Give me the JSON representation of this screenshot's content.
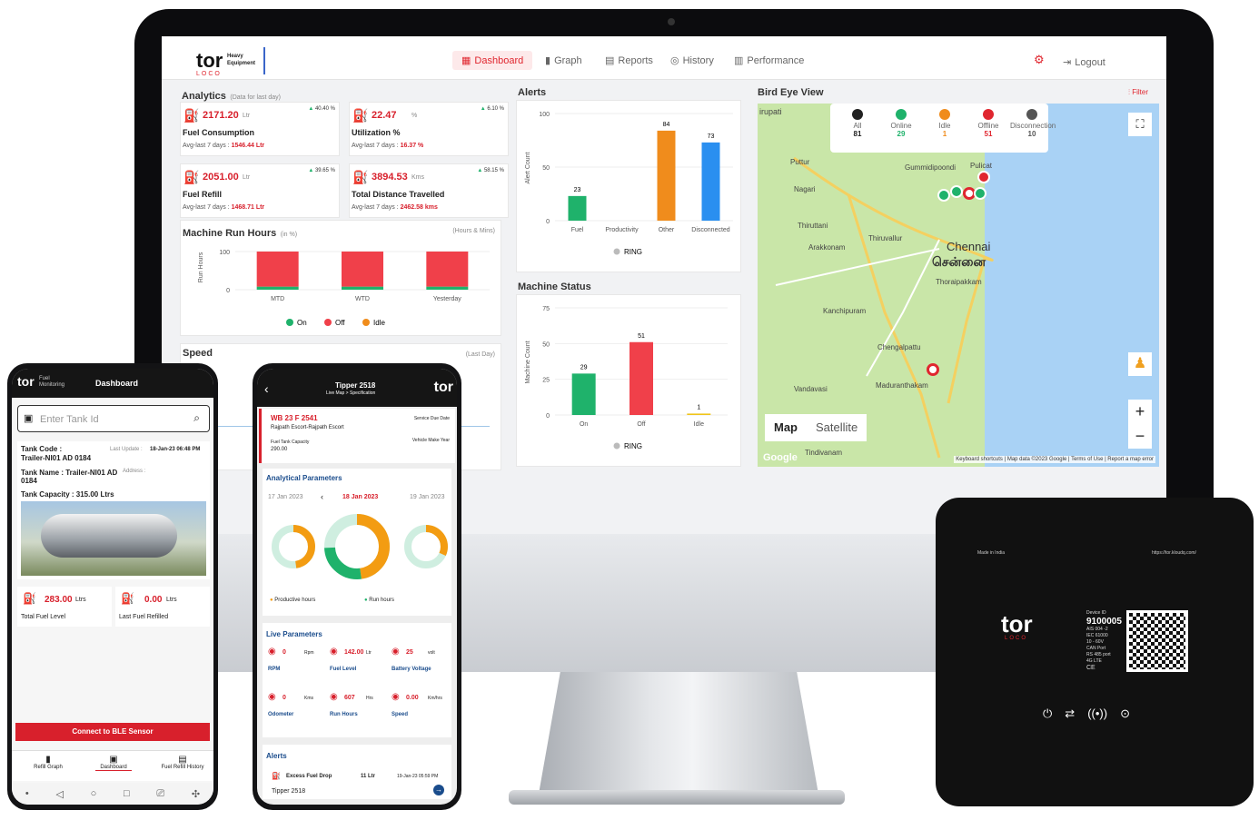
{
  "web": {
    "logo": {
      "brand": "tor",
      "sub1": "Heavy",
      "sub2": "Equipment",
      "loco": "LOCO"
    },
    "nav": [
      {
        "label": "Dashboard",
        "icon": "grid-icon"
      },
      {
        "label": "Graph",
        "icon": "bar-chart-icon"
      },
      {
        "label": "Reports",
        "icon": "report-icon"
      },
      {
        "label": "History",
        "icon": "history-icon"
      },
      {
        "label": "Performance",
        "icon": "performance-icon"
      }
    ],
    "logout": "Logout",
    "analytics": {
      "title": "Analytics",
      "subtitle": "(Data for last day)",
      "cards": [
        {
          "value": "2171.20",
          "unit": "Ltr",
          "pct": "40.40 %",
          "label": "Fuel Consumption",
          "avg_label": "Avg-last 7 days :",
          "avg_value": "1546.44 Ltr"
        },
        {
          "value": "22.47",
          "unit": "%",
          "pct": "6.10 %",
          "label": "Utilization %",
          "avg_label": "Avg-last 7 days :",
          "avg_value": "16.37 %"
        },
        {
          "value": "2051.00",
          "unit": "Ltr",
          "pct": "39.65 %",
          "label": "Fuel Refill",
          "avg_label": "Avg-last 7 days :",
          "avg_value": "1468.71 Ltr"
        },
        {
          "value": "3894.53",
          "unit": "Kms",
          "pct": "58.15 %",
          "label": "Total Distance Travelled",
          "avg_label": "Avg-last 7 days :",
          "avg_value": "2462.58 kms"
        }
      ]
    },
    "run_hours": {
      "title": "Machine Run Hours",
      "unit": "(in %)",
      "right": "(Hours & Mins)",
      "ylabel": "Run Hours",
      "chart_data": {
        "type": "bar",
        "stacked": true,
        "categories": [
          "MTD",
          "WTD",
          "Yesterday"
        ],
        "series": [
          {
            "name": "On",
            "values": [
              8,
              8,
              8
            ],
            "color": "#1fb26b"
          },
          {
            "name": "Off",
            "values": [
              92,
              92,
              92
            ],
            "color": "#f0404a"
          },
          {
            "name": "Idle",
            "values": [
              0,
              0,
              0
            ],
            "color": "#f08c1c"
          }
        ],
        "ylim": [
          0,
          100
        ],
        "yticks": [
          "100",
          "0"
        ]
      }
    },
    "speed": {
      "title": "Speed",
      "right": "(Last Day)"
    },
    "alerts": {
      "title": "Alerts",
      "ylabel": "Alert Count",
      "legend": "RING",
      "chart_data": {
        "type": "bar",
        "categories": [
          "Fuel",
          "Productivity",
          "Other",
          "Disconnected"
        ],
        "values": [
          23,
          0,
          84,
          73
        ],
        "colors": [
          "#1fb26b",
          "#9b59b6",
          "#f08c1c",
          "#2a8ff0"
        ],
        "ylim": [
          0,
          100
        ],
        "yticks": [
          "100",
          "50",
          "0"
        ]
      }
    },
    "machine_status": {
      "title": "Machine Status",
      "ylabel": "Machine Count",
      "legend": "RING",
      "chart_data": {
        "type": "bar",
        "categories": [
          "On",
          "Off",
          "Idle"
        ],
        "values": [
          29,
          51,
          1
        ],
        "colors": [
          "#1fb26b",
          "#f0404a",
          "#f0c419"
        ],
        "ylim": [
          0,
          75
        ],
        "yticks": [
          "75",
          "50",
          "25",
          "0"
        ]
      }
    },
    "bird_eye": {
      "title": "Bird Eye View",
      "filter": "Filter",
      "stats": [
        {
          "label": "All",
          "value": "81",
          "color": "#222"
        },
        {
          "label": "Online",
          "value": "29",
          "color": "#1fb26b"
        },
        {
          "label": "Idle",
          "value": "1",
          "color": "#f08c1c"
        },
        {
          "label": "Offline",
          "value": "51",
          "color": "#e0262f"
        },
        {
          "label": "Disconnection",
          "value": "10",
          "color": "#555"
        }
      ],
      "map_btn": "Map",
      "sat_btn": "Satellite",
      "places": [
        "Chennai",
        "சென்னை",
        "Gummidipoondi",
        "Nagari",
        "Puttur",
        "Thiruttani",
        "Arakkonam",
        "Thiruvallur",
        "Kanchipuram",
        "Chengalpattu",
        "Maduranthakam",
        "Vandavasi",
        "Tindivanam",
        "Thoraipakkam",
        "Pulicat",
        "irupati"
      ],
      "footer": "Keyboard shortcuts | Map data ©2023 Google | Terms of Use | Report a map error",
      "google": "Google"
    }
  },
  "phone1": {
    "title": "Dashboard",
    "logo_sub1": "Fuel",
    "logo_sub2": "Monitoring",
    "search_placeholder": "Enter Tank Id",
    "tank_code_label": "Tank Code :",
    "tank_code": "Trailer-NI01 AD 0184",
    "last_update_label": "Last Update :",
    "last_update": "18-Jan-23 06:48 PM",
    "tank_name": "Tank Name : Trailer-NI01 AD 0184",
    "address": "Address :",
    "capacity": "Tank Capacity : 315.00 Ltrs",
    "total_fuel": "283.00",
    "total_fuel_unit": "Ltrs",
    "total_fuel_label": "Total Fuel Level",
    "last_refill": "0.00",
    "last_refill_unit": "Ltrs",
    "last_refill_label": "Last Fuel Refilled",
    "connect": "Connect to BLE Sensor",
    "tabs": [
      "Refill Graph",
      "Dashboard",
      "Fuel Refill History"
    ]
  },
  "phone2": {
    "title": "Tipper 2518",
    "subtitle": "Live Map > Specification",
    "reg": "WB 23 F 2541",
    "route": "Rajpath Escort-Rajpath Escort",
    "service_label": "Service Due Date",
    "fuel_cap_label": "Fuel Tank Capacity",
    "fuel_cap": "290.00",
    "make_label": "Vehicle Make Year",
    "analytical": "Analytical Parameters",
    "dates": [
      "17 Jan 2023",
      "18 Jan 2023",
      "19 Jan 2023"
    ],
    "legend_prod": "Productive hours",
    "legend_run": "Run hours",
    "live": "Live Parameters",
    "params": [
      {
        "v": "0",
        "u": "Rpm",
        "l": "RPM"
      },
      {
        "v": "142.00",
        "u": "Ltr",
        "l": "Fuel Level"
      },
      {
        "v": "25",
        "u": "volt",
        "l": "Battery Voltage"
      },
      {
        "v": "0",
        "u": "Kms",
        "l": "Odometer"
      },
      {
        "v": "607",
        "u": "Hrs",
        "l": "Run Hours"
      },
      {
        "v": "0.00",
        "u": "Km/hrs",
        "l": "Speed"
      }
    ],
    "alerts": "Alerts",
    "alert_name": "Excess Fuel Drop",
    "alert_val": "11 Ltr",
    "alert_time": "19-Jan-23 05:59 PM",
    "alert_vehicle": "Tipper 2518"
  },
  "device": {
    "made": "Made in India",
    "url": "https://tor.kloudq.com/",
    "brand": "tor",
    "loco": "LOCO",
    "device_id_label": "Device ID",
    "device_id": "9100005",
    "spec1": "AIS 004 -2",
    "spec2": "IEC 61000",
    "spec3": "10 - 60V",
    "spec4": "CAN Port",
    "spec5": "RS 485 port",
    "spec6": "4G LTE",
    "ce": "CE"
  }
}
